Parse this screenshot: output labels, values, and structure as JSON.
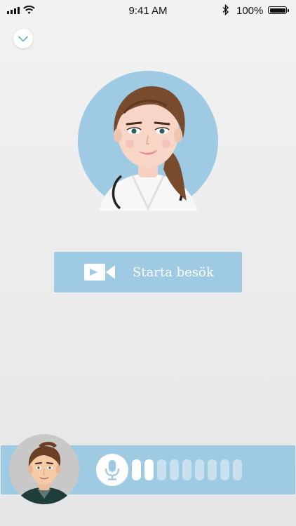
{
  "status_bar": {
    "time": "9:41 AM",
    "battery_percent": "100%"
  },
  "collapse_button": {
    "icon": "chevron-down-icon"
  },
  "doctor_avatar": {
    "icon": "doctor-avatar"
  },
  "start_button": {
    "icon": "video-camera-icon",
    "label": "Starta besök"
  },
  "call_bar": {
    "patient_avatar": "patient-avatar",
    "mic_icon": "microphone-icon",
    "level_bars_total": 9,
    "level_bars_active": 2
  },
  "colors": {
    "accent": "#9ecae3",
    "meter_inactive": "#c9e1ef",
    "background": "#eeeeee"
  }
}
